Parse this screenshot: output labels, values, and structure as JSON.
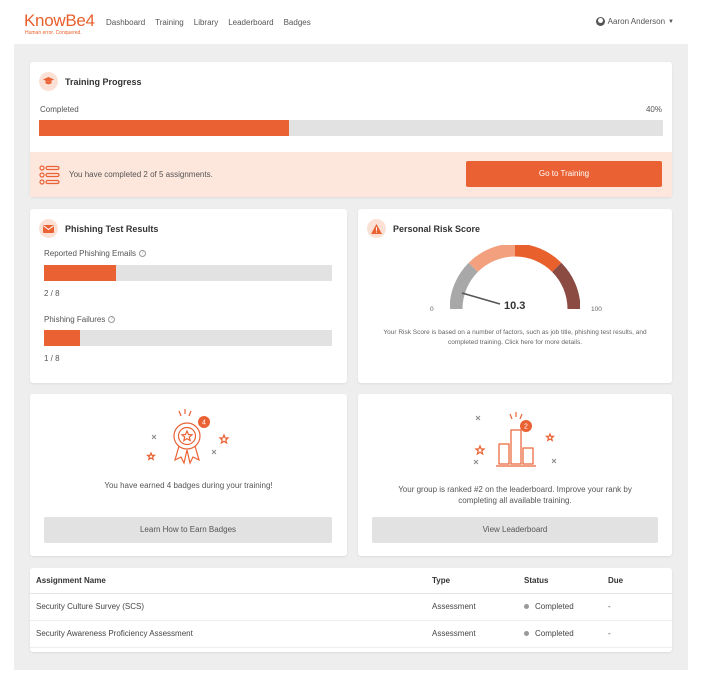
{
  "brand": {
    "name": "KnowBe4",
    "tagline": "Human error. Conquered.",
    "accent": "#ea6234"
  },
  "nav": {
    "items": [
      "Dashboard",
      "Training",
      "Library",
      "Leaderboard",
      "Badges"
    ]
  },
  "user": {
    "name": "Aaron Anderson"
  },
  "training": {
    "title": "Training Progress",
    "completed_label": "Completed",
    "percent_label": "40%",
    "progress": 0.4,
    "message": "You have completed 2 of 5 assignments.",
    "button": "Go to Training"
  },
  "phishing": {
    "title": "Phishing Test Results",
    "reported_label": "Reported Phishing Emails",
    "reported_value": "2 / 8",
    "reported_fraction": 0.25,
    "failures_label": "Phishing Failures",
    "failures_value": "1 / 8",
    "failures_fraction": 0.125
  },
  "risk": {
    "title": "Personal Risk Score",
    "score": "10.3",
    "min": "0",
    "max": "100",
    "description": "Your Risk Score is based on a number of factors, such as job title, phishing test results, and completed training. Click here for more details."
  },
  "badges": {
    "count": "4",
    "text": "You have earned 4 badges during your training!",
    "button": "Learn How to Earn Badges"
  },
  "leaderboard": {
    "rank": "2",
    "text": "Your group is ranked #2 on the leaderboard. Improve your rank by completing all available training.",
    "button": "View Leaderboard"
  },
  "assignments": {
    "headers": {
      "name": "Assignment Name",
      "type": "Type",
      "status": "Status",
      "due": "Due"
    },
    "rows": [
      {
        "name": "Security Culture Survey (SCS)",
        "type": "Assessment",
        "status": "Completed",
        "due": "-"
      },
      {
        "name": "Security Awareness Proficiency Assessment",
        "type": "Assessment",
        "status": "Completed",
        "due": "-"
      }
    ]
  }
}
